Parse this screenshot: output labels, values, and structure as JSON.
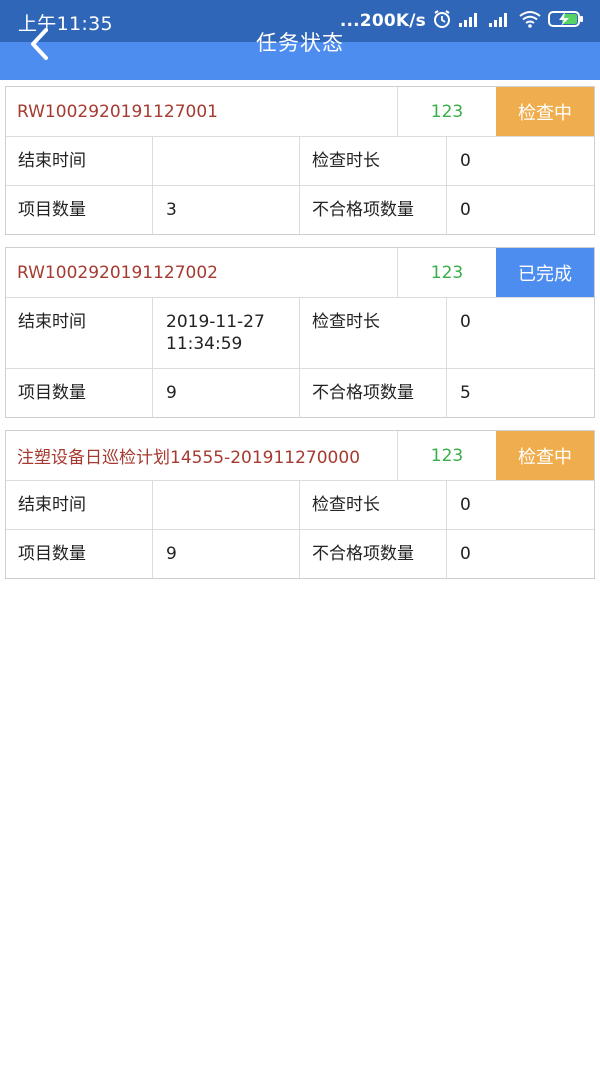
{
  "status_bar": {
    "time": "上午11:35",
    "network_speed": "...200K/s"
  },
  "header": {
    "title": "任务状态"
  },
  "colors": {
    "status_bar_bg": "#2F66B8",
    "app_bar_bg": "#4E8DF0",
    "task_id_text": "#A63A30",
    "count_text": "#3AAE48",
    "status_checking_bg": "#F0AD4E",
    "status_done_bg": "#4E8DF0"
  },
  "tasks": [
    {
      "id": "RW1002920191127001",
      "count": "123",
      "status": "检查中",
      "end_time_label": "结束时间",
      "end_time": "",
      "duration_label": "检查时长",
      "duration": "0",
      "item_count_label": "项目数量",
      "item_count": "3",
      "fail_count_label": "不合格项数量",
      "fail_count": "0"
    },
    {
      "id": "RW1002920191127002",
      "count": "123",
      "status": "已完成",
      "end_time_label": "结束时间",
      "end_time": "2019-11-27 11:34:59",
      "duration_label": "检查时长",
      "duration": "0",
      "item_count_label": "项目数量",
      "item_count": "9",
      "fail_count_label": "不合格项数量",
      "fail_count": "5"
    },
    {
      "id": "注塑设备日巡检计划14555-201911270000",
      "count": "123",
      "status": "检查中",
      "end_time_label": "结束时间",
      "end_time": "",
      "duration_label": "检查时长",
      "duration": "0",
      "item_count_label": "项目数量",
      "item_count": "9",
      "fail_count_label": "不合格项数量",
      "fail_count": "0"
    }
  ]
}
